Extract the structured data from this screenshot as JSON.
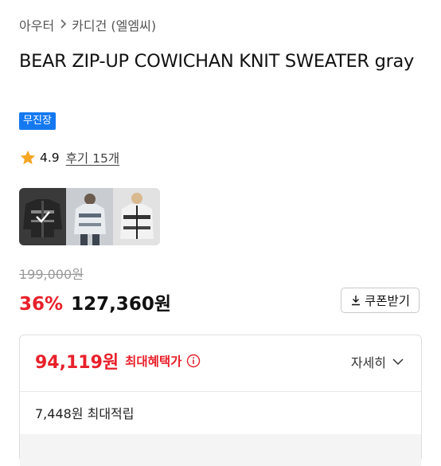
{
  "breadcrumb": {
    "category": "아우터",
    "subcategory": "카디건 (엘엠씨)"
  },
  "product": {
    "title": "BEAR ZIP-UP COWICHAN KNIT SWEATER gray",
    "badge": "무진장"
  },
  "rating": {
    "score": "4.9",
    "reviews": "후기 15개",
    "star_color": "#f5a623"
  },
  "thumbnails": [
    {
      "name": "thumbnail-knit-flat",
      "selected": true
    },
    {
      "name": "thumbnail-model-front",
      "selected": false
    },
    {
      "name": "thumbnail-model-detail",
      "selected": false
    }
  ],
  "pricing": {
    "original": "199,000원",
    "discount": "36%",
    "price": "127,360원",
    "coupon_label": "쿠폰받기"
  },
  "best_price": {
    "value": "94,119원",
    "label": "최대혜택가",
    "detail_label": "자세히",
    "points": "7,448원 최대적립"
  },
  "colors": {
    "accent_red": "#e8202a",
    "badge_blue": "#1479f0"
  }
}
